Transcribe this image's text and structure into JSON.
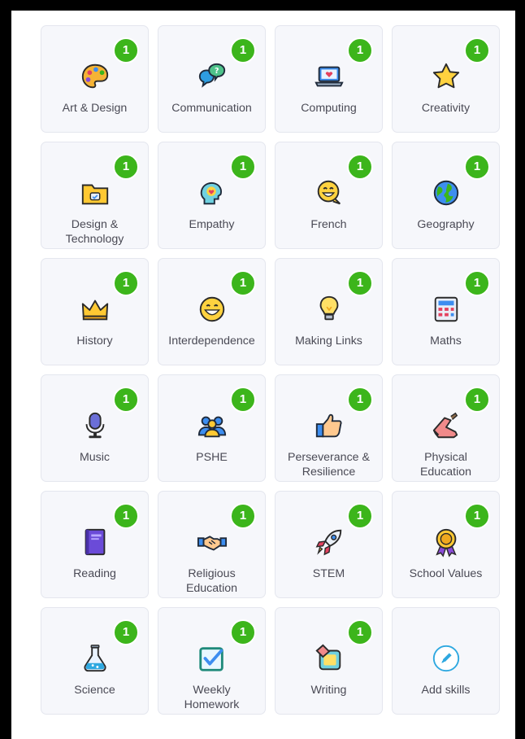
{
  "skills": [
    {
      "label": "Art & Design",
      "count": "1",
      "icon": "palette-icon"
    },
    {
      "label": "Communication",
      "count": "1",
      "icon": "speech-bubbles-icon"
    },
    {
      "label": "Computing",
      "count": "1",
      "icon": "laptop-icon"
    },
    {
      "label": "Creativity",
      "count": "1",
      "icon": "star-icon"
    },
    {
      "label": "Design &\nTechnology",
      "count": "1",
      "icon": "folder-icon"
    },
    {
      "label": "Empathy",
      "count": "1",
      "icon": "head-heart-icon"
    },
    {
      "label": "French",
      "count": "1",
      "icon": "smiley-speech-icon"
    },
    {
      "label": "Geography",
      "count": "1",
      "icon": "globe-icon"
    },
    {
      "label": "History",
      "count": "1",
      "icon": "crown-icon"
    },
    {
      "label": "Interdependence",
      "count": "1",
      "icon": "smiley-face-icon"
    },
    {
      "label": "Making Links",
      "count": "1",
      "icon": "lightbulb-icon"
    },
    {
      "label": "Maths",
      "count": "1",
      "icon": "calculator-icon"
    },
    {
      "label": "Music",
      "count": "1",
      "icon": "microphone-icon"
    },
    {
      "label": "PSHE",
      "count": "1",
      "icon": "people-icon"
    },
    {
      "label": "Perseverance &\nResilience",
      "count": "1",
      "icon": "thumbs-up-icon"
    },
    {
      "label": "Physical\nEducation",
      "count": "1",
      "icon": "sneaker-icon"
    },
    {
      "label": "Reading",
      "count": "1",
      "icon": "book-icon"
    },
    {
      "label": "Religious\nEducation",
      "count": "1",
      "icon": "handshake-icon"
    },
    {
      "label": "STEM",
      "count": "1",
      "icon": "rocket-icon"
    },
    {
      "label": "School Values",
      "count": "1",
      "icon": "award-ribbon-icon"
    },
    {
      "label": "Science",
      "count": "1",
      "icon": "flask-icon"
    },
    {
      "label": "Weekly\nHomework",
      "count": "1",
      "icon": "checkbox-icon"
    },
    {
      "label": "Writing",
      "count": "1",
      "icon": "eraser-icon"
    },
    {
      "label": "Add skills",
      "count": "",
      "icon": "pencil-circle-icon"
    }
  ],
  "colors": {
    "badge": "#3cb51b",
    "tile_bg": "#f6f7fb",
    "label": "#4a4a55",
    "add_accent": "#2ea8e0"
  }
}
